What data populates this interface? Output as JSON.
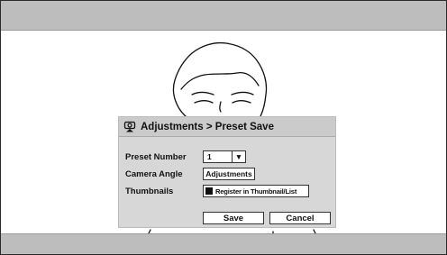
{
  "dialog": {
    "title": "Adjustments > Preset Save",
    "title_icon": "camera-icon",
    "preset_number": {
      "label": "Preset Number",
      "value": "1",
      "arrow": "▼"
    },
    "camera_angle": {
      "label": "Camera Angle",
      "button_label": "Adjustments"
    },
    "thumbnails": {
      "label": "Thumbnails",
      "checkbox_label": "Register in Thumbnail/List",
      "checked": true
    },
    "save_label": "Save",
    "cancel_label": "Cancel"
  }
}
